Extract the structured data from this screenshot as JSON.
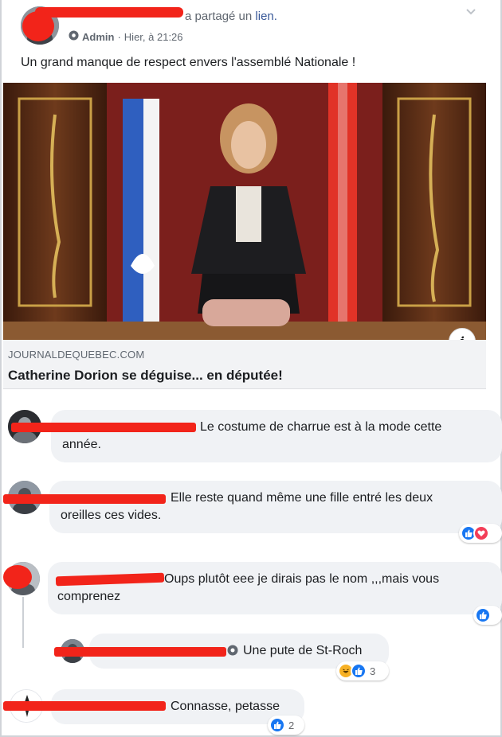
{
  "post": {
    "author_suffix": "a partagé un",
    "link_word": "lien.",
    "role": "Admin",
    "time": "Hier, à 21:26",
    "text": "Un grand manque de respect envers l'assemblé Nationale !"
  },
  "link": {
    "domain": "JOURNALDEQUEBEC.COM",
    "title": "Catherine Dorion se déguise... en députée!",
    "info_label": "i"
  },
  "comments": [
    {
      "text": "Le costume de charrue est à la mode cette",
      "text2": "année.",
      "reactions": ""
    },
    {
      "text": "Elle reste quand même une fille entré les deux",
      "text2": "oreilles ces vides.",
      "reactions": ""
    },
    {
      "text": "Oups plutôt eee je dirais pas le nom ,,,mais vous",
      "text2": "comprenez",
      "reactions": ""
    },
    {
      "text": "Une pute de St-Roch",
      "reactions": "3"
    },
    {
      "text": "Connasse, petasse",
      "reactions": "2"
    }
  ],
  "colors": {
    "link_blue": "#385898",
    "redaction": "#f2241a",
    "like": "#1877f2",
    "love": "#f33e58",
    "haha": "#f7b125"
  },
  "icons": [
    "shield-icon",
    "chevron-down-icon",
    "like-icon",
    "love-icon",
    "haha-icon",
    "info-icon"
  ]
}
